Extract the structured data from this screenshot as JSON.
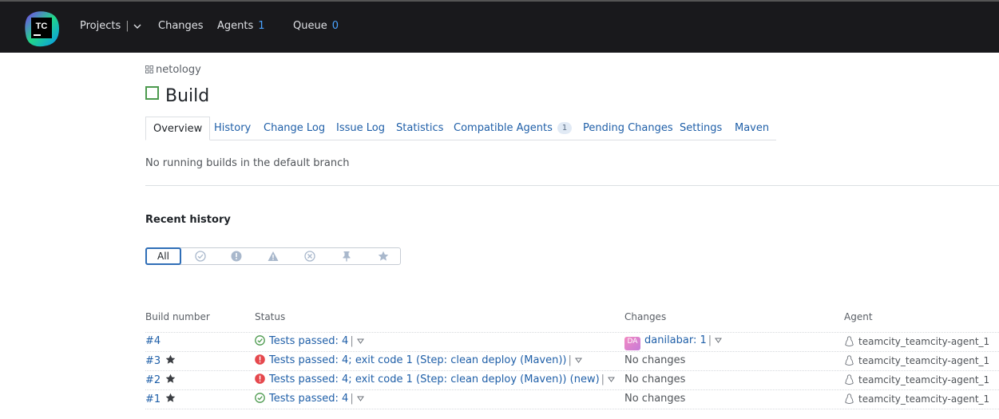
{
  "topbar": {
    "logo_text": "TC",
    "projects_label": "Projects",
    "changes_label": "Changes",
    "agents_label": "Agents",
    "agents_count": "1",
    "queue_label": "Queue",
    "queue_count": "0"
  },
  "breadcrumb": {
    "project": "netology"
  },
  "page_title": "Build",
  "tabs": [
    {
      "label": "Overview",
      "active": true
    },
    {
      "label": "History"
    },
    {
      "label": "Change Log"
    },
    {
      "label": "Issue Log"
    },
    {
      "label": "Statistics"
    },
    {
      "label": "Compatible Agents",
      "count": "1"
    },
    {
      "label": "Pending Changes"
    },
    {
      "label": "Settings"
    },
    {
      "label": "Maven"
    }
  ],
  "no_running_text": "No running builds in the default branch",
  "recent_history": {
    "heading": "Recent history",
    "filter_all_label": "All",
    "filter_icons": [
      "check-circle-icon",
      "exclamation-circle-icon",
      "warning-triangle-icon",
      "cancel-circle-icon",
      "pin-icon",
      "star-icon"
    ]
  },
  "table": {
    "headers": {
      "build_number": "Build number",
      "status": "Status",
      "changes": "Changes",
      "agent": "Agent"
    },
    "rows": [
      {
        "number": "#4",
        "starred": false,
        "status_type": "success",
        "status": "Tests passed: 4",
        "changes_avatar": "DA",
        "changes": "danilabar: 1",
        "agent": "teamcity_teamcity-agent_1"
      },
      {
        "number": "#3",
        "starred": true,
        "status_type": "error",
        "status": "Tests passed: 4; exit code 1 (Step: clean deploy (Maven))",
        "changes": "No changes",
        "agent": "teamcity_teamcity-agent_1"
      },
      {
        "number": "#2",
        "starred": true,
        "status_type": "error",
        "status": "Tests passed: 4; exit code 1 (Step: clean deploy (Maven)) (new)",
        "changes": "No changes",
        "agent": "teamcity_teamcity-agent_1"
      },
      {
        "number": "#1",
        "starred": true,
        "status_type": "success",
        "status": "Tests passed: 4",
        "changes": "No changes",
        "agent": "teamcity_teamcity-agent_1"
      }
    ]
  },
  "colors": {
    "topbar_bg": "#19191c",
    "link": "#1f5fa8",
    "success": "#4c9a4e",
    "error": "#e5484d",
    "accent": "#4aa3ff"
  }
}
